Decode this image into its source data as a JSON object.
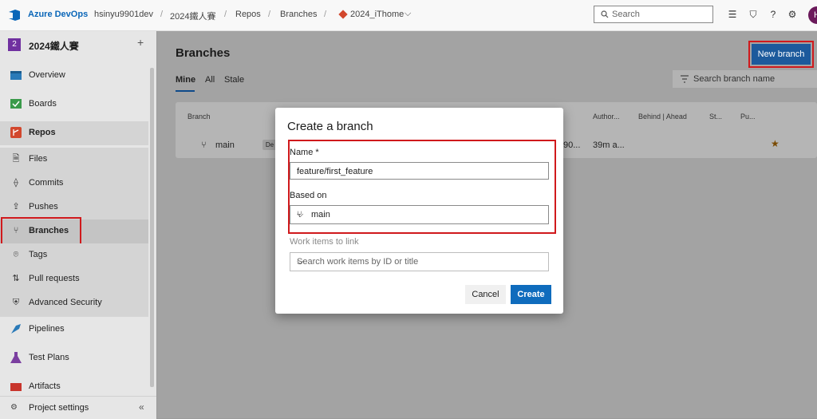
{
  "topbar": {
    "brand": "Azure DevOps",
    "crumbs": [
      "hsinyu9901dev",
      "2024鐵人賽",
      "Repos",
      "Branches",
      "2024_iThome"
    ],
    "search_placeholder": "Search",
    "avatar_initial": "H"
  },
  "sidebar": {
    "project_badge": "2",
    "project_name": "2024鐵人賽",
    "items": [
      {
        "label": "Overview"
      },
      {
        "label": "Boards"
      },
      {
        "label": "Repos"
      },
      {
        "label": "Files"
      },
      {
        "label": "Commits"
      },
      {
        "label": "Pushes"
      },
      {
        "label": "Branches"
      },
      {
        "label": "Tags"
      },
      {
        "label": "Pull requests"
      },
      {
        "label": "Advanced Security"
      },
      {
        "label": "Pipelines"
      },
      {
        "label": "Test Plans"
      },
      {
        "label": "Artifacts"
      }
    ],
    "settings": "Project settings",
    "collapse": "«"
  },
  "main": {
    "title": "Branches",
    "new_branch": "New branch",
    "tabs": [
      "Mine",
      "All",
      "Stale"
    ],
    "search_placeholder": "Search branch name",
    "columns": [
      "Branch",
      "Author...",
      "Behind | Ahead",
      "St...",
      "Pu..."
    ],
    "row": {
      "name": "main",
      "badge": "De",
      "commit": "90...",
      "time": "39m a..."
    }
  },
  "dialog": {
    "title": "Create a branch",
    "name_label": "Name *",
    "name_value": "feature/first_feature",
    "based_on_label": "Based on",
    "based_on_value": "main",
    "work_items_label": "Work items to link",
    "work_items_placeholder": "Search work items by ID or title",
    "cancel": "Cancel",
    "create": "Create"
  },
  "colors": {
    "accent": "#0f6cbd",
    "highlight": "#d0191c"
  }
}
